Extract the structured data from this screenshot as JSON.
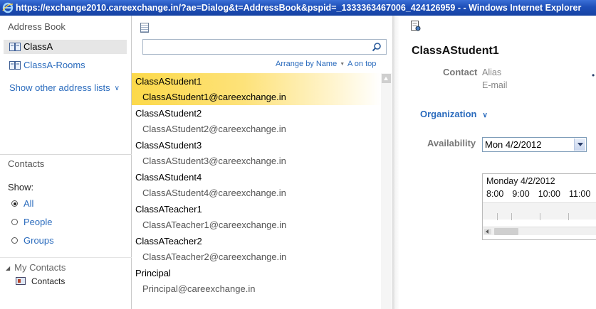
{
  "window": {
    "title": "https://exchange2010.careexchange.in/?ae=Dialog&t=AddressBook&pspid=_1333363467006_424126959 - - Windows Internet Explorer"
  },
  "left": {
    "address_book_title": "Address Book",
    "books": [
      {
        "label": "ClassA",
        "selected": true
      },
      {
        "label": "ClassA-Rooms",
        "selected": false
      }
    ],
    "show_other": "Show other address lists",
    "contacts_title": "Contacts",
    "show_label": "Show:",
    "filters": [
      {
        "label": "All",
        "checked": true
      },
      {
        "label": "People",
        "checked": false
      },
      {
        "label": "Groups",
        "checked": false
      }
    ],
    "my_contacts": "My Contacts",
    "contacts_leaf": "Contacts"
  },
  "middle": {
    "search": {
      "value": "",
      "placeholder": ""
    },
    "arrange_label": "Arrange by Name",
    "order_label": "A on top",
    "entries": [
      {
        "name": "ClassAStudent1",
        "email": "ClassAStudent1@careexchange.in",
        "selected": true
      },
      {
        "name": "ClassAStudent2",
        "email": "ClassAStudent2@careexchange.in",
        "selected": false
      },
      {
        "name": "ClassAStudent3",
        "email": "ClassAStudent3@careexchange.in",
        "selected": false
      },
      {
        "name": "ClassAStudent4",
        "email": "ClassAStudent4@careexchange.in",
        "selected": false
      },
      {
        "name": "ClassATeacher1",
        "email": "ClassATeacher1@careexchange.in",
        "selected": false
      },
      {
        "name": "ClassATeacher2",
        "email": "ClassATeacher2@careexchange.in",
        "selected": false
      },
      {
        "name": "Principal",
        "email": "Principal@careexchange.in",
        "selected": false
      }
    ]
  },
  "right": {
    "person_name": "ClassAStudent1",
    "contact_label": "Contact",
    "alias_label": "Alias",
    "email_label": "E-mail",
    "organization_label": "Organization",
    "availability_label": "Availability",
    "date_value": "Mon 4/2/2012",
    "calendar": {
      "day": "Monday 4/2/2012",
      "hours": [
        "8:00",
        "9:00",
        "10:00",
        "11:00"
      ]
    }
  },
  "colors": {
    "link": "#2a6bbd",
    "selection": "#fcd94a",
    "titlebar": "#1e4fb8"
  }
}
